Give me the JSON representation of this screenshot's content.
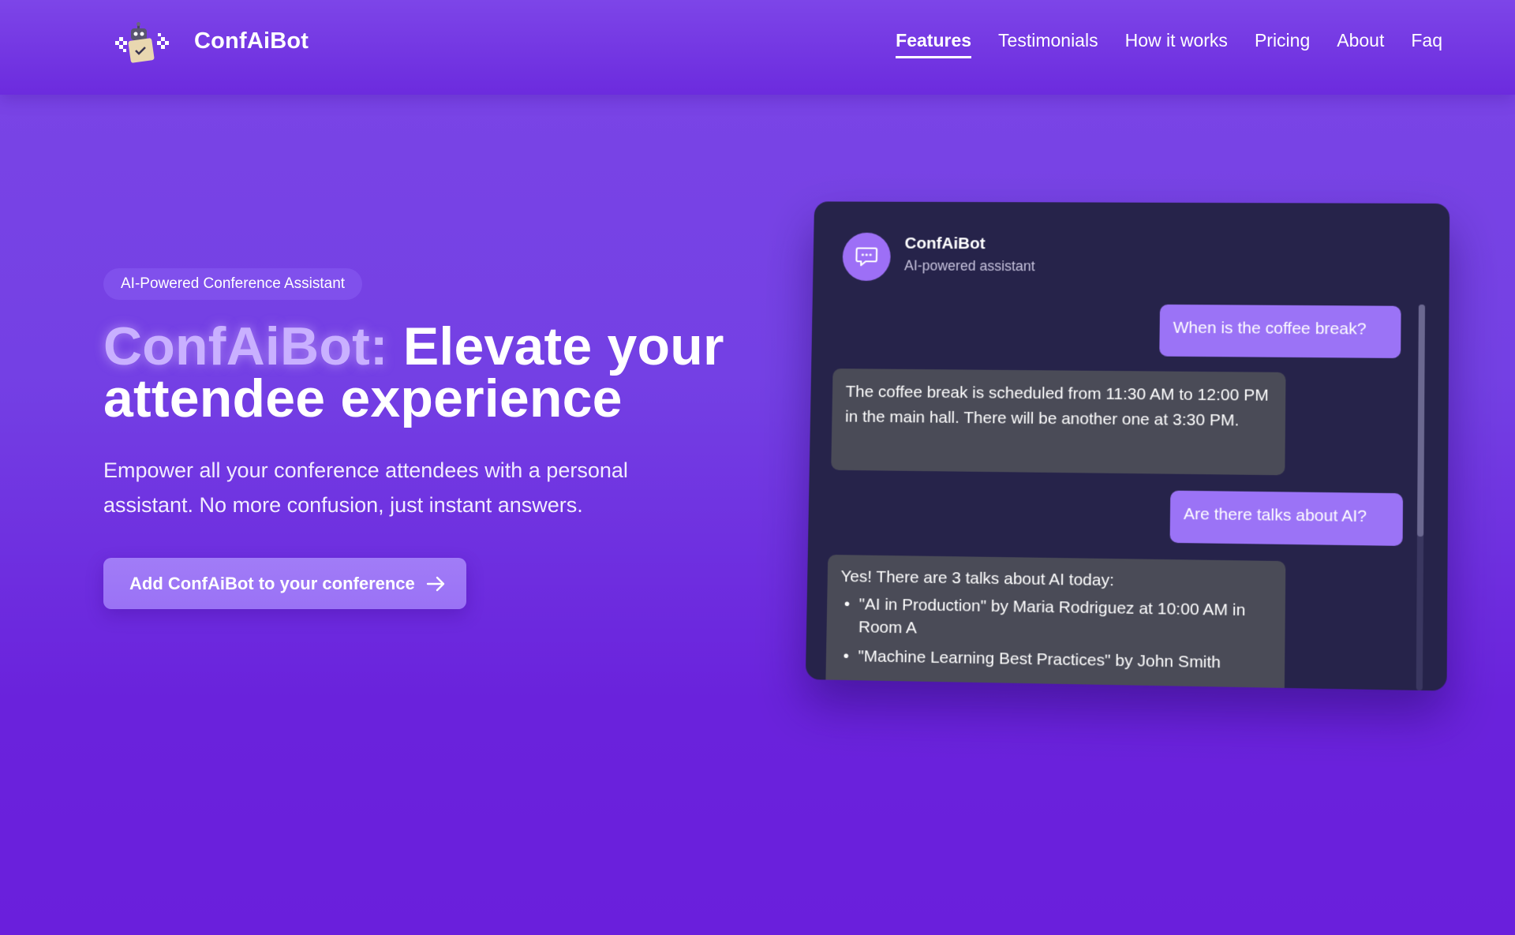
{
  "header": {
    "brand": "ConfAiBot",
    "nav": [
      {
        "label": "Features",
        "active": true
      },
      {
        "label": "Testimonials",
        "active": false
      },
      {
        "label": "How it works",
        "active": false
      },
      {
        "label": "Pricing",
        "active": false
      },
      {
        "label": "About",
        "active": false
      },
      {
        "label": "Faq",
        "active": false
      }
    ]
  },
  "hero": {
    "badge": "AI-Powered Conference Assistant",
    "headline_brand": "ConfAiBot:",
    "headline_rest": "Elevate your attendee experience",
    "subtitle": "Empower all your conference attendees with a personal assistant. No more confusion, just instant answers.",
    "cta_label": "Add ConfAiBot to your conference"
  },
  "chat": {
    "title": "ConfAiBot",
    "subtitle": "AI-powered assistant",
    "messages": [
      {
        "role": "user",
        "text": "When is the coffee break?"
      },
      {
        "role": "bot",
        "text": "The coffee break is scheduled from 11:30 AM to 12:00 PM in the main hall. There will be another one at 3:30 PM."
      },
      {
        "role": "user",
        "text": "Are there talks about AI?"
      },
      {
        "role": "bot",
        "text": "Yes! There are 3 talks about AI today:",
        "items": [
          "\"AI in Production\" by Maria Rodriguez at 10:00 AM in Room A",
          "\"Machine Learning Best Practices\" by John Smith"
        ]
      }
    ]
  },
  "colors": {
    "background": "#7440e4",
    "accent": "#9b73f6",
    "chat_bg": "#26234a",
    "bot_bubble": "#4a4b57",
    "brand_highlight": "#c9b0ff"
  },
  "icons": {
    "logo": "robot-logo-icon",
    "chat_avatar": "chat-bubble-icon",
    "cta_arrow": "arrow-right-icon"
  }
}
